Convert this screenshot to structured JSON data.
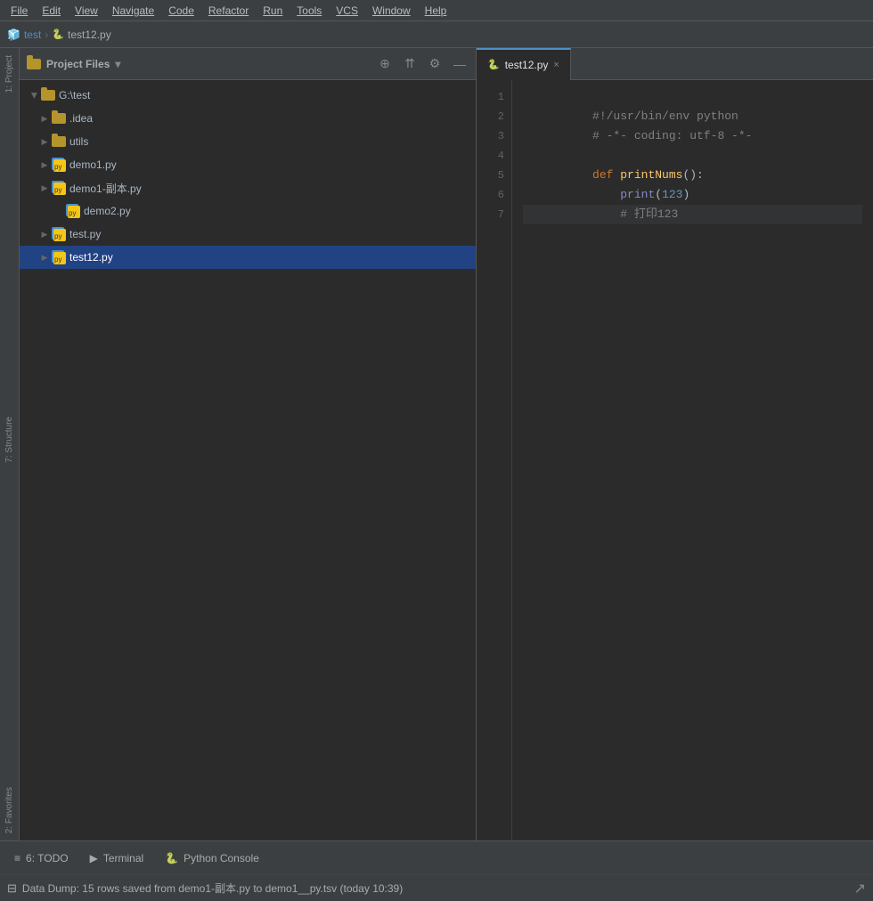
{
  "menubar": {
    "items": [
      "File",
      "Edit",
      "View",
      "Navigate",
      "Code",
      "Refactor",
      "Run",
      "Tools",
      "VCS",
      "Window",
      "Help"
    ]
  },
  "breadcrumb": {
    "project": "test",
    "file": "test12.py"
  },
  "left_strip": {
    "labels": [
      "1: Project",
      "7: Structure",
      "2: Favorites"
    ]
  },
  "file_tree": {
    "header_title": "Project Files",
    "header_dropdown": "▾",
    "icons": {
      "add": "+",
      "collapse": "⇈",
      "settings": "⚙",
      "close": "—"
    },
    "root": {
      "name": "G:\\test",
      "children": [
        {
          "type": "folder",
          "name": ".idea",
          "indent": 2,
          "open": false
        },
        {
          "type": "folder",
          "name": "utils",
          "indent": 2,
          "open": false
        },
        {
          "type": "pyfile",
          "name": "demo1.py",
          "indent": 2
        },
        {
          "type": "pyfile",
          "name": "demo1-副本.py",
          "indent": 2
        },
        {
          "type": "pyfile",
          "name": "demo2.py",
          "indent": 3
        },
        {
          "type": "pyfile",
          "name": "test.py",
          "indent": 2
        },
        {
          "type": "pyfile",
          "name": "test12.py",
          "indent": 2,
          "selected": true
        }
      ]
    }
  },
  "editor": {
    "tab_label": "test12.py",
    "tab_close": "×",
    "lines": [
      {
        "num": 1,
        "content": "#!/usr/bin/env python",
        "type": "shebang"
      },
      {
        "num": 2,
        "content": "# -*- coding: utf-8 -*-",
        "type": "comment"
      },
      {
        "num": 3,
        "content": "",
        "type": "empty"
      },
      {
        "num": 4,
        "content": "def printNums():",
        "type": "def"
      },
      {
        "num": 5,
        "content": "    print(123)",
        "type": "call"
      },
      {
        "num": 6,
        "content": "    # 打印123",
        "type": "comment-inline"
      },
      {
        "num": 7,
        "content": "",
        "type": "empty-last",
        "highlighted": true
      }
    ]
  },
  "bottom_tabs": [
    {
      "label": "6: TODO",
      "icon": "≡"
    },
    {
      "label": "Terminal",
      "icon": "▶"
    },
    {
      "label": "Python Console",
      "icon": "🐍"
    }
  ],
  "status_bar": {
    "icon": "⊟",
    "text": "Data Dump: 15 rows saved from demo1-副本.py to demo1__py.tsv (today 10:39)"
  }
}
